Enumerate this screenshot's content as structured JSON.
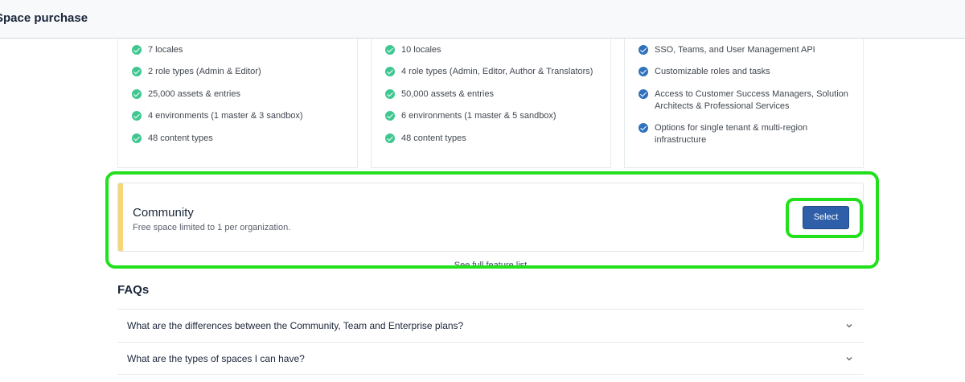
{
  "header": {
    "title": "Space purchase"
  },
  "plans": [
    {
      "features": [
        "7 locales",
        "2 role types (Admin & Editor)",
        "25,000 assets & entries",
        "4 environments (1 master & 3 sandbox)",
        "48 content types"
      ]
    },
    {
      "features": [
        "10 locales",
        "4 role types (Admin, Editor, Author & Translators)",
        "50,000 assets & entries",
        "6 environments (1 master & 5 sandbox)",
        "48 content types"
      ]
    },
    {
      "features": [
        "SSO, Teams, and User Management API",
        "Customizable roles and tasks",
        "Access to Customer Success Managers, Solution Architects & Professional Services",
        "Options for single tenant & multi-region infrastructure"
      ]
    }
  ],
  "community": {
    "title": "Community",
    "description": "Free space limited to 1 per organization.",
    "select_label": "Select"
  },
  "see_full_link": "See full feature list",
  "faqs": {
    "heading": "FAQs",
    "items": [
      {
        "question": "What are the differences between the Community, Team and Enterprise plans?"
      },
      {
        "question": "What are the types of spaces I can have?"
      }
    ]
  },
  "colors": {
    "check_green": "#3ec791",
    "check_blue": "#3072be",
    "accent_yellow": "#f7d67a",
    "primary_button": "#2e5fa8",
    "highlight": "#22e01c"
  },
  "icons": {
    "feature_check": "check-circle-icon",
    "faq_toggle": "chevron-down-icon"
  }
}
